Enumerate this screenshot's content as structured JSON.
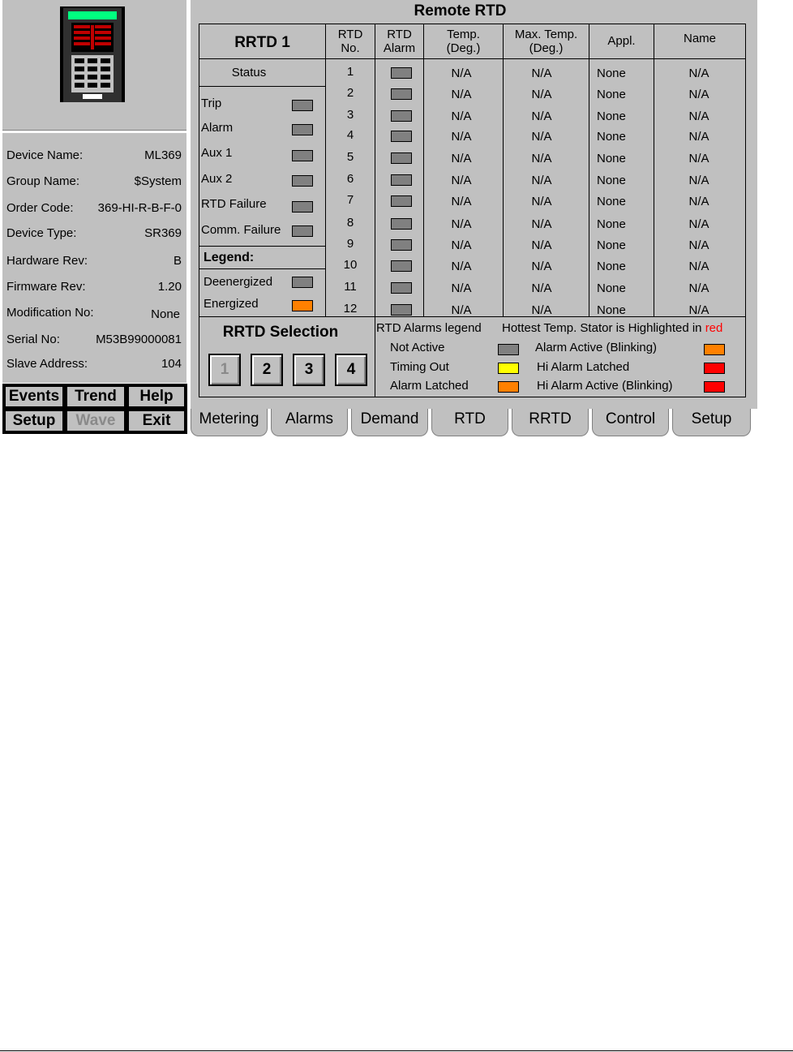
{
  "device_panel": {
    "info": [
      {
        "label": "Device Name:",
        "value": "ML369"
      },
      {
        "label": "Group Name:",
        "value": "$System"
      },
      {
        "label": "Order Code:",
        "value": "369-HI-R-B-F-0"
      },
      {
        "label": "Device Type:",
        "value": "SR369"
      },
      {
        "label": "Hardware Rev:",
        "value": "B"
      },
      {
        "label": "Firmware Rev:",
        "value": "1.20"
      },
      {
        "label": "Modification No:",
        "value": "None"
      },
      {
        "label": "Serial No:",
        "value": "M53B99000081"
      },
      {
        "label": "Slave Address:",
        "value": "104"
      }
    ]
  },
  "nav_buttons": {
    "events": "Events",
    "trend": "Trend",
    "help": "Help",
    "setup": "Setup",
    "wave": "Wave",
    "exit": "Exit"
  },
  "main": {
    "title": "Remote RTD",
    "rrtd_label": "RRTD 1",
    "status_label": "Status",
    "status_items": [
      {
        "label": "Trip",
        "state": "grey"
      },
      {
        "label": "Alarm",
        "state": "grey"
      },
      {
        "label": "Aux 1",
        "state": "grey"
      },
      {
        "label": "Aux 2",
        "state": "grey"
      },
      {
        "label": "RTD Failure",
        "state": "grey"
      },
      {
        "label": "Comm. Failure",
        "state": "grey"
      }
    ],
    "legend_label": "Legend:",
    "legend_items": [
      {
        "label": "Deenergized",
        "color": "#808080"
      },
      {
        "label": "Energized",
        "color": "#ff8000"
      }
    ],
    "columns": {
      "rtd_no": [
        "RTD",
        "No."
      ],
      "rtd_alarm": [
        "RTD",
        "Alarm"
      ],
      "temp": [
        "Temp.",
        "(Deg.)"
      ],
      "max_temp": [
        "Max. Temp.",
        "(Deg.)"
      ],
      "appl": "Appl.",
      "name": "Name"
    },
    "rows": [
      {
        "no": "1",
        "alarm": "grey",
        "temp": "N/A",
        "max": "N/A",
        "appl": "None",
        "name": "N/A"
      },
      {
        "no": "2",
        "alarm": "grey",
        "temp": "N/A",
        "max": "N/A",
        "appl": "None",
        "name": "N/A"
      },
      {
        "no": "3",
        "alarm": "grey",
        "temp": "N/A",
        "max": "N/A",
        "appl": "None",
        "name": "N/A"
      },
      {
        "no": "4",
        "alarm": "grey",
        "temp": "N/A",
        "max": "N/A",
        "appl": "None",
        "name": "N/A"
      },
      {
        "no": "5",
        "alarm": "grey",
        "temp": "N/A",
        "max": "N/A",
        "appl": "None",
        "name": "N/A"
      },
      {
        "no": "6",
        "alarm": "grey",
        "temp": "N/A",
        "max": "N/A",
        "appl": "None",
        "name": "N/A"
      },
      {
        "no": "7",
        "alarm": "grey",
        "temp": "N/A",
        "max": "N/A",
        "appl": "None",
        "name": "N/A"
      },
      {
        "no": "8",
        "alarm": "grey",
        "temp": "N/A",
        "max": "N/A",
        "appl": "None",
        "name": "N/A"
      },
      {
        "no": "9",
        "alarm": "grey",
        "temp": "N/A",
        "max": "N/A",
        "appl": "None",
        "name": "N/A"
      },
      {
        "no": "10",
        "alarm": "grey",
        "temp": "N/A",
        "max": "N/A",
        "appl": "None",
        "name": "N/A"
      },
      {
        "no": "11",
        "alarm": "grey",
        "temp": "N/A",
        "max": "N/A",
        "appl": "None",
        "name": "N/A"
      },
      {
        "no": "12",
        "alarm": "grey",
        "temp": "N/A",
        "max": "N/A",
        "appl": "None",
        "name": "N/A"
      }
    ],
    "selection_title": "RRTD Selection",
    "selection_buttons": [
      "1",
      "2",
      "3",
      "4"
    ],
    "selected": "1",
    "alarm_legend_title": "RTD Alarms legend",
    "hottest_text": "Hottest Temp. Stator is Highlighted in",
    "hottest_color_word": "red",
    "alarm_legend": [
      {
        "label": "Not Active",
        "color": "#808080"
      },
      {
        "label": "Timing Out",
        "color": "#ffff00"
      },
      {
        "label": "Alarm Latched",
        "color": "#ff8000"
      },
      {
        "label": "Alarm Active (Blinking)",
        "color": "#ff8000"
      },
      {
        "label": "Hi Alarm Latched",
        "color": "#ff0000"
      },
      {
        "label": "Hi Alarm Active (Blinking)",
        "color": "#ff0000"
      }
    ]
  },
  "tabs": [
    "Metering",
    "Alarms",
    "Demand",
    "RTD",
    "RRTD",
    "Control",
    "Setup"
  ],
  "active_tab": "RRTD"
}
